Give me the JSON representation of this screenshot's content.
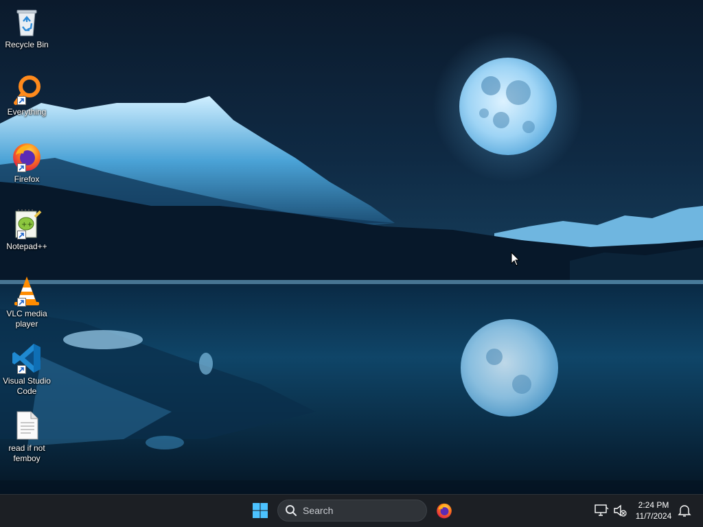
{
  "desktop": {
    "icons": [
      {
        "name": "recycle-bin",
        "label": "Recycle Bin",
        "icon": "recycle-bin-icon",
        "shortcut": false
      },
      {
        "name": "everything",
        "label": "Everything",
        "icon": "everything-search-icon",
        "shortcut": true
      },
      {
        "name": "firefox",
        "label": "Firefox",
        "icon": "firefox-icon",
        "shortcut": true
      },
      {
        "name": "notepad-plus-plus",
        "label": "Notepad++",
        "icon": "notepad-plus-plus-icon",
        "shortcut": true
      },
      {
        "name": "vlc",
        "label": "VLC media player",
        "icon": "vlc-icon",
        "shortcut": true
      },
      {
        "name": "vscode",
        "label": "Visual Studio Code",
        "icon": "vscode-icon",
        "shortcut": true
      },
      {
        "name": "text-file",
        "label": "read if not femboy",
        "icon": "text-file-icon",
        "shortcut": false
      }
    ],
    "wallpaper": {
      "theme": "night lake with full moon and snowy mountains",
      "sky": "#0d2036",
      "accent": "#4fa8e0"
    }
  },
  "taskbar": {
    "start_icon": "windows-start-icon",
    "search_placeholder": "Search",
    "pinned": [
      {
        "name": "firefox",
        "icon": "firefox-icon"
      }
    ],
    "tray": {
      "network_icon": "network-icon",
      "volume_icon": "volume-muted-icon",
      "notification_icon": "bell-icon"
    },
    "clock": {
      "time": "2:24 PM",
      "date": "11/7/2024"
    }
  }
}
